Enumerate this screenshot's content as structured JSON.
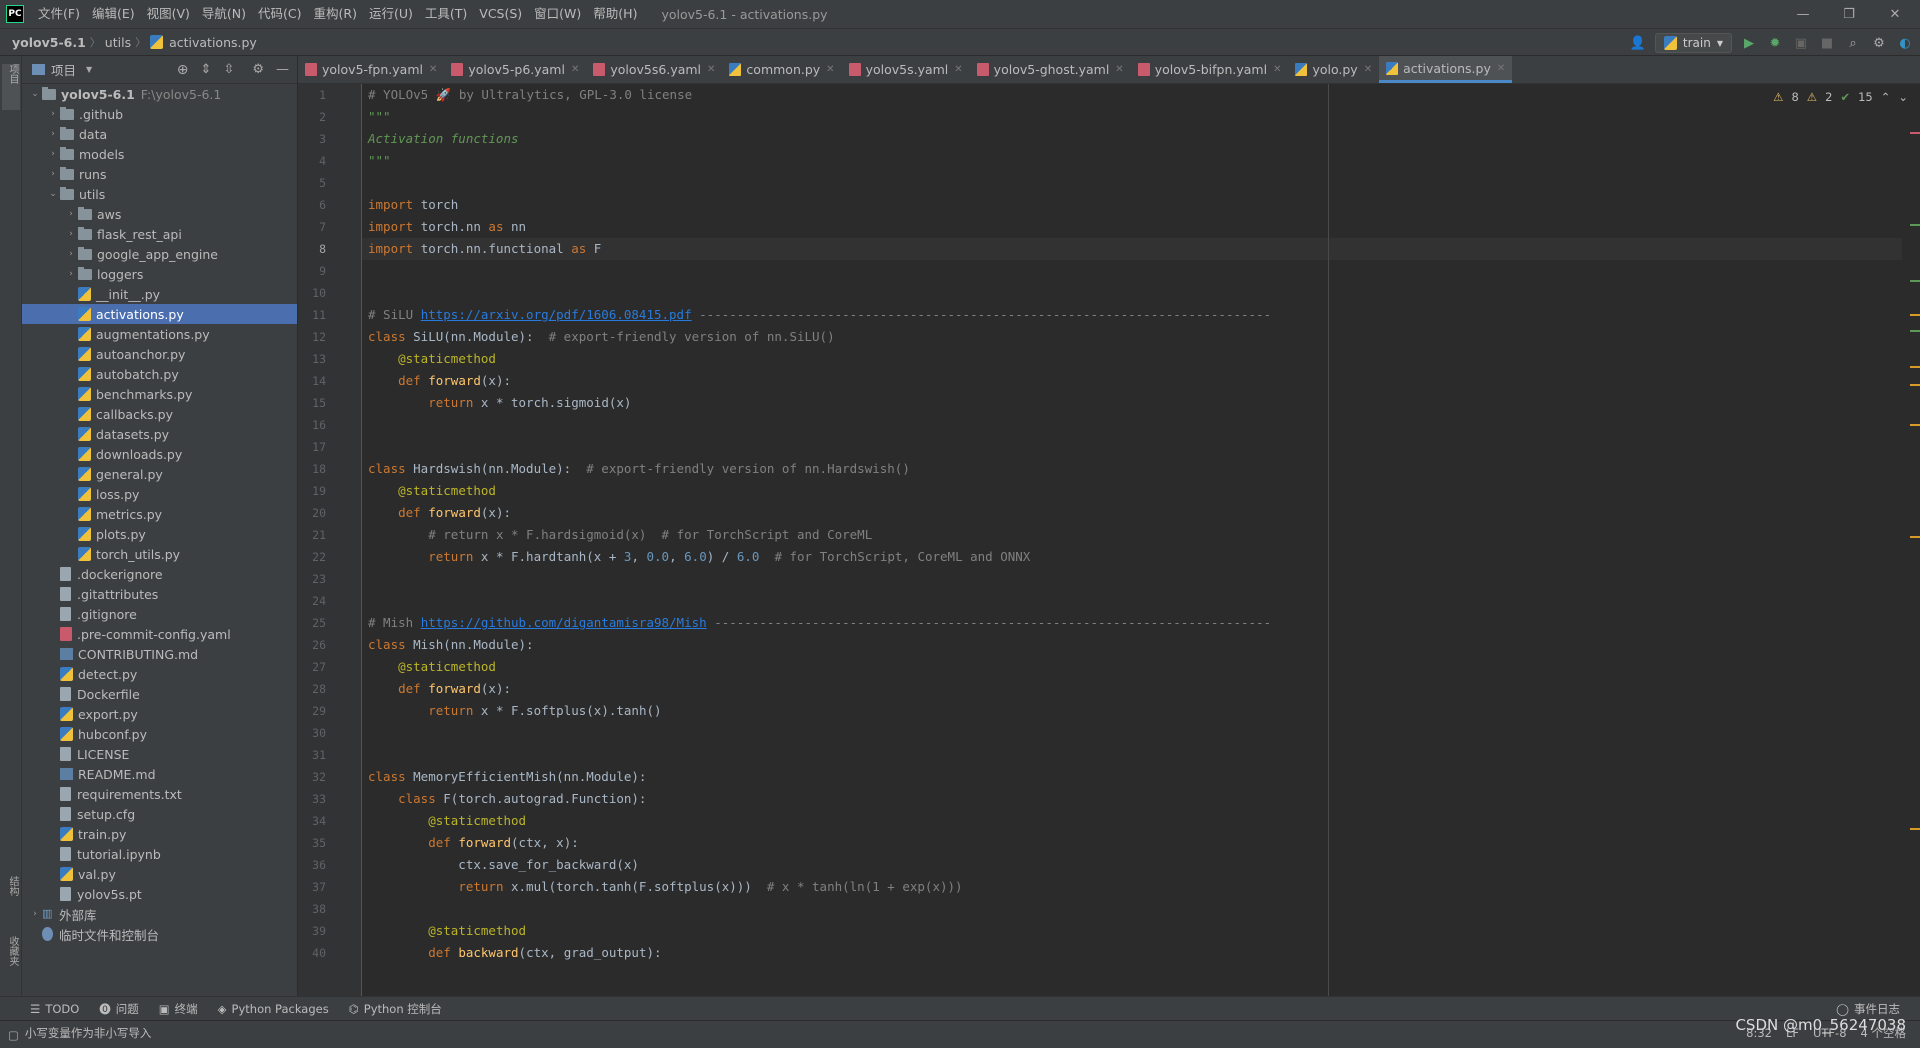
{
  "titlebar": {
    "app_icon": "PC",
    "menus": [
      "文件(F)",
      "编辑(E)",
      "视图(V)",
      "导航(N)",
      "代码(C)",
      "重构(R)",
      "运行(U)",
      "工具(T)",
      "VCS(S)",
      "窗口(W)",
      "帮助(H)"
    ],
    "window_title": "yolov5-6.1 - activations.py"
  },
  "navbar": {
    "crumbs": [
      "yolov5-6.1",
      "utils",
      "activations.py"
    ],
    "run_config": "train"
  },
  "left_strip": {
    "project": "项目",
    "structure": "结构",
    "favorites": "收藏夹"
  },
  "project": {
    "header": "项目",
    "tree": [
      {
        "label": "yolov5-6.1",
        "path": "F:\\yolov5-6.1",
        "type": "folder",
        "depth": 0,
        "open": true,
        "bold": true
      },
      {
        "label": ".github",
        "type": "folder",
        "depth": 1
      },
      {
        "label": "data",
        "type": "folder",
        "depth": 1
      },
      {
        "label": "models",
        "type": "folder",
        "depth": 1
      },
      {
        "label": "runs",
        "type": "folder",
        "depth": 1
      },
      {
        "label": "utils",
        "type": "folder",
        "depth": 1,
        "open": true
      },
      {
        "label": "aws",
        "type": "folder",
        "depth": 2
      },
      {
        "label": "flask_rest_api",
        "type": "folder",
        "depth": 2
      },
      {
        "label": "google_app_engine",
        "type": "folder",
        "depth": 2
      },
      {
        "label": "loggers",
        "type": "folder",
        "depth": 2
      },
      {
        "label": "__init__.py",
        "type": "py",
        "depth": 2
      },
      {
        "label": "activations.py",
        "type": "py",
        "depth": 2,
        "selected": true
      },
      {
        "label": "augmentations.py",
        "type": "py",
        "depth": 2
      },
      {
        "label": "autoanchor.py",
        "type": "py",
        "depth": 2
      },
      {
        "label": "autobatch.py",
        "type": "py",
        "depth": 2
      },
      {
        "label": "benchmarks.py",
        "type": "py",
        "depth": 2
      },
      {
        "label": "callbacks.py",
        "type": "py",
        "depth": 2
      },
      {
        "label": "datasets.py",
        "type": "py",
        "depth": 2
      },
      {
        "label": "downloads.py",
        "type": "py",
        "depth": 2
      },
      {
        "label": "general.py",
        "type": "py",
        "depth": 2
      },
      {
        "label": "loss.py",
        "type": "py",
        "depth": 2
      },
      {
        "label": "metrics.py",
        "type": "py",
        "depth": 2
      },
      {
        "label": "plots.py",
        "type": "py",
        "depth": 2
      },
      {
        "label": "torch_utils.py",
        "type": "py",
        "depth": 2
      },
      {
        "label": ".dockerignore",
        "type": "file",
        "depth": 1
      },
      {
        "label": ".gitattributes",
        "type": "file",
        "depth": 1
      },
      {
        "label": ".gitignore",
        "type": "file",
        "depth": 1
      },
      {
        "label": ".pre-commit-config.yaml",
        "type": "yaml",
        "depth": 1
      },
      {
        "label": "CONTRIBUTING.md",
        "type": "md",
        "depth": 1
      },
      {
        "label": "detect.py",
        "type": "py",
        "depth": 1
      },
      {
        "label": "Dockerfile",
        "type": "file",
        "depth": 1
      },
      {
        "label": "export.py",
        "type": "py",
        "depth": 1
      },
      {
        "label": "hubconf.py",
        "type": "py",
        "depth": 1
      },
      {
        "label": "LICENSE",
        "type": "file",
        "depth": 1
      },
      {
        "label": "README.md",
        "type": "md",
        "depth": 1
      },
      {
        "label": "requirements.txt",
        "type": "file",
        "depth": 1
      },
      {
        "label": "setup.cfg",
        "type": "file",
        "depth": 1
      },
      {
        "label": "train.py",
        "type": "py",
        "depth": 1
      },
      {
        "label": "tutorial.ipynb",
        "type": "file",
        "depth": 1
      },
      {
        "label": "val.py",
        "type": "py",
        "depth": 1
      },
      {
        "label": "yolov5s.pt",
        "type": "file",
        "depth": 1
      },
      {
        "label": "外部库",
        "type": "lib",
        "depth": 0
      },
      {
        "label": "临时文件和控制台",
        "type": "scratch",
        "depth": 0
      }
    ]
  },
  "tabs": [
    {
      "label": "yolov5-fpn.yaml",
      "type": "yaml"
    },
    {
      "label": "yolov5-p6.yaml",
      "type": "yaml"
    },
    {
      "label": "yolov5s6.yaml",
      "type": "yaml"
    },
    {
      "label": "common.py",
      "type": "py"
    },
    {
      "label": "yolov5s.yaml",
      "type": "yaml"
    },
    {
      "label": "yolov5-ghost.yaml",
      "type": "yaml"
    },
    {
      "label": "yolov5-bifpn.yaml",
      "type": "yaml"
    },
    {
      "label": "yolo.py",
      "type": "py"
    },
    {
      "label": "activations.py",
      "type": "py",
      "active": true
    }
  ],
  "inspection": {
    "warnings": "8",
    "weak_warnings": "2",
    "typos": "15"
  },
  "editor": {
    "current_line": 8,
    "lines": [
      [
        [
          "cm",
          "# YOLOv5 🚀 by Ultralytics, GPL-3.0 license"
        ]
      ],
      [
        [
          "doc",
          "\"\"\""
        ]
      ],
      [
        [
          "doc",
          "Activation functions"
        ]
      ],
      [
        [
          "doc",
          "\"\"\""
        ]
      ],
      [],
      [
        [
          "kw",
          "import "
        ],
        [
          "cl",
          "torch"
        ]
      ],
      [
        [
          "kw",
          "import "
        ],
        [
          "cl",
          "torch.nn "
        ],
        [
          "kw",
          "as "
        ],
        [
          "cl",
          "nn"
        ]
      ],
      [
        [
          "kw",
          "import "
        ],
        [
          "cl",
          "torch.nn.functional "
        ],
        [
          "kw",
          "as "
        ],
        [
          "cl",
          "F"
        ]
      ],
      [],
      [],
      [
        [
          "cm",
          "# SiLU "
        ],
        [
          "url",
          "https://arxiv.org/pdf/1606.08415.pdf"
        ],
        [
          "cm",
          " ----------------------------------------------------------------------------"
        ]
      ],
      [
        [
          "kw",
          "class "
        ],
        [
          "cl",
          "SiLU(nn.Module):  "
        ],
        [
          "cm",
          "# export-friendly version of nn.SiLU()"
        ]
      ],
      [
        [
          "cl",
          "    "
        ],
        [
          "dec",
          "@staticmethod"
        ]
      ],
      [
        [
          "cl",
          "    "
        ],
        [
          "kw",
          "def "
        ],
        [
          "fn",
          "forward"
        ],
        [
          "cl",
          "(x):"
        ]
      ],
      [
        [
          "cl",
          "        "
        ],
        [
          "kw",
          "return "
        ],
        [
          "cl",
          "x * torch.sigmoid(x)"
        ]
      ],
      [],
      [],
      [
        [
          "kw",
          "class "
        ],
        [
          "cl",
          "Hardswish(nn.Module):  "
        ],
        [
          "cm",
          "# export-friendly version of nn.Hardswish()"
        ]
      ],
      [
        [
          "cl",
          "    "
        ],
        [
          "dec",
          "@staticmethod"
        ]
      ],
      [
        [
          "cl",
          "    "
        ],
        [
          "kw",
          "def "
        ],
        [
          "fn",
          "forward"
        ],
        [
          "cl",
          "(x):"
        ]
      ],
      [
        [
          "cl",
          "        "
        ],
        [
          "cm",
          "# return x * F.hardsigmoid(x)  # for TorchScript and CoreML"
        ]
      ],
      [
        [
          "cl",
          "        "
        ],
        [
          "kw",
          "return "
        ],
        [
          "cl",
          "x * F.hardtanh(x + "
        ],
        [
          "num",
          "3"
        ],
        [
          "cl",
          ", "
        ],
        [
          "num",
          "0.0"
        ],
        [
          "cl",
          ", "
        ],
        [
          "num",
          "6.0"
        ],
        [
          "cl",
          ") / "
        ],
        [
          "num",
          "6.0"
        ],
        [
          "cm",
          "  # for TorchScript, CoreML and ONNX"
        ]
      ],
      [],
      [],
      [
        [
          "cm",
          "# Mish "
        ],
        [
          "url",
          "https://github.com/digantamisra98/Mish"
        ],
        [
          "cm",
          " --------------------------------------------------------------------------"
        ]
      ],
      [
        [
          "kw",
          "class "
        ],
        [
          "cl",
          "Mish(nn.Module):"
        ]
      ],
      [
        [
          "cl",
          "    "
        ],
        [
          "dec",
          "@staticmethod"
        ]
      ],
      [
        [
          "cl",
          "    "
        ],
        [
          "kw",
          "def "
        ],
        [
          "fn",
          "forward"
        ],
        [
          "cl",
          "(x):"
        ]
      ],
      [
        [
          "cl",
          "        "
        ],
        [
          "kw",
          "return "
        ],
        [
          "cl",
          "x * F.softplus(x).tanh()"
        ]
      ],
      [],
      [],
      [
        [
          "kw",
          "class "
        ],
        [
          "cl",
          "MemoryEfficientMish(nn.Module):"
        ]
      ],
      [
        [
          "cl",
          "    "
        ],
        [
          "kw",
          "class "
        ],
        [
          "cl",
          "F(torch.autograd.Function):"
        ]
      ],
      [
        [
          "cl",
          "        "
        ],
        [
          "dec",
          "@staticmethod"
        ]
      ],
      [
        [
          "cl",
          "        "
        ],
        [
          "kw",
          "def "
        ],
        [
          "fn",
          "forward"
        ],
        [
          "cl",
          "(ctx, x):"
        ]
      ],
      [
        [
          "cl",
          "            ctx.save_for_backward(x)"
        ]
      ],
      [
        [
          "cl",
          "            "
        ],
        [
          "kw",
          "return "
        ],
        [
          "cl",
          "x.mul(torch.tanh(F.softplus(x)))  "
        ],
        [
          "cm",
          "# x * tanh(ln(1 + exp(x)))"
        ]
      ],
      [],
      [
        [
          "cl",
          "        "
        ],
        [
          "dec",
          "@staticmethod"
        ]
      ],
      [
        [
          "cl",
          "        "
        ],
        [
          "kw",
          "def "
        ],
        [
          "fn",
          "backward"
        ],
        [
          "cl",
          "(ctx, grad_output):"
        ]
      ]
    ]
  },
  "bottom_tools": [
    "TODO",
    "问题",
    "终端",
    "Python Packages",
    "Python 控制台"
  ],
  "event_log": "事件日志",
  "status": {
    "message": "小写变量作为非小写导入",
    "position": "8:32",
    "line_sep": "LF",
    "encoding": "UTF-8",
    "indent": "4 个空格"
  },
  "watermark": "CSDN @m0_56247038"
}
